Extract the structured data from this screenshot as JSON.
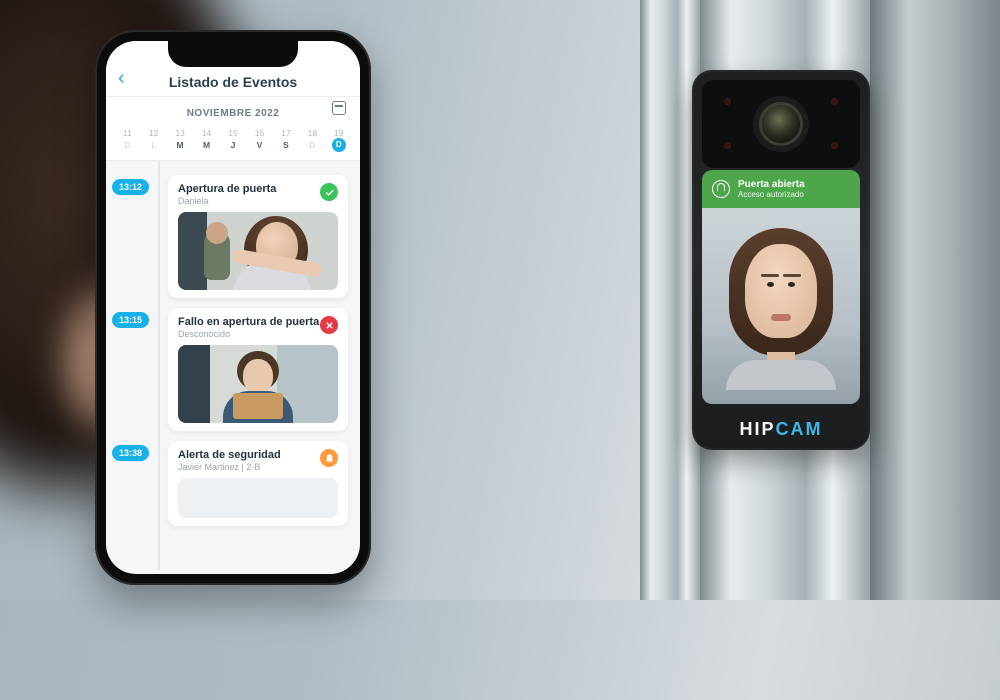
{
  "phone": {
    "header": {
      "title": "Listado de Eventos"
    },
    "month": {
      "label": "NOVIEMBRE 2022"
    },
    "calendar": {
      "nums": [
        "11",
        "12",
        "13",
        "14",
        "15",
        "16",
        "17",
        "18",
        "19"
      ],
      "dows": [
        "D",
        "L",
        "M",
        "M",
        "J",
        "V",
        "S",
        "D"
      ],
      "current": "D"
    },
    "events": [
      {
        "time": "13:12",
        "title": "Apertura de puerta",
        "subtitle": "Daniela",
        "status": "ok"
      },
      {
        "time": "13:15",
        "title": "Fallo en apertura de puerta",
        "subtitle": "Desconocido",
        "status": "fail"
      },
      {
        "time": "13:38",
        "title": "Alerta de seguridad",
        "subtitle": "Javier Martinez | 2-B",
        "status": "alert"
      }
    ]
  },
  "device": {
    "status": {
      "line1": "Puerta abierta",
      "line2": "Acceso autorizado"
    },
    "brand": {
      "left": "HIP",
      "right": "CAM"
    }
  }
}
